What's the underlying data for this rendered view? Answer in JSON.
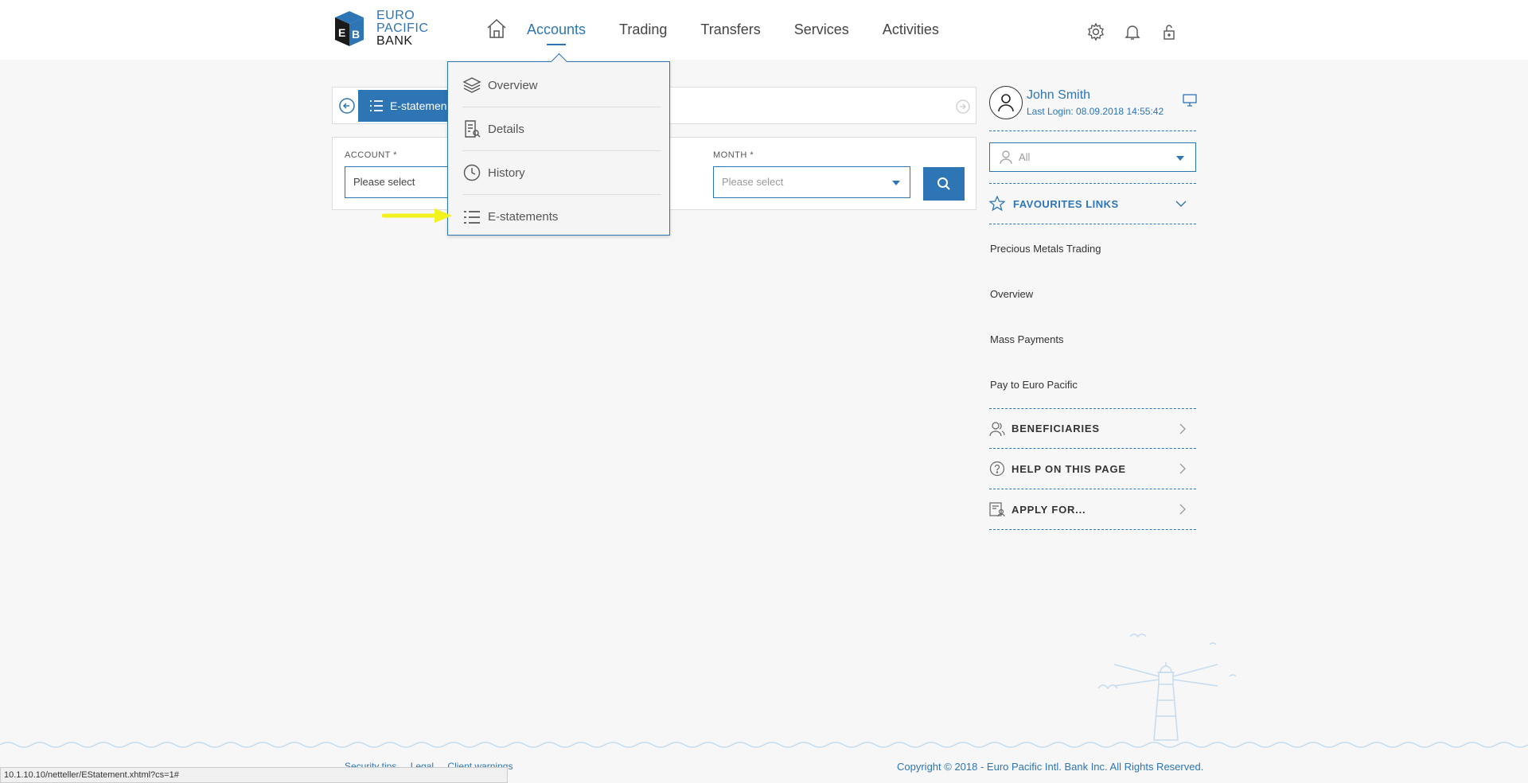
{
  "brand": {
    "line1": "EURO",
    "line2": "PACIFIC",
    "line3": "BANK",
    "accent_color": "#2e75b6"
  },
  "nav": {
    "items": [
      {
        "label": "Accounts",
        "active": true
      },
      {
        "label": "Trading"
      },
      {
        "label": "Transfers"
      },
      {
        "label": "Services"
      },
      {
        "label": "Activities"
      }
    ],
    "icons": [
      "home-icon",
      "gear-icon",
      "bell-icon",
      "unlock-icon"
    ]
  },
  "accounts_menu": {
    "items": [
      {
        "label": "Overview",
        "icon": "layers-icon"
      },
      {
        "label": "Details",
        "icon": "document-search-icon"
      },
      {
        "label": "History",
        "icon": "clock-icon"
      },
      {
        "label": "E-statements",
        "icon": "list-icon"
      }
    ]
  },
  "tabs": {
    "active_label": "E-statements"
  },
  "filter": {
    "account_label": "ACCOUNT *",
    "account_value": "Please select",
    "year_value": "",
    "month_label": "MONTH *",
    "month_placeholder": "Please select"
  },
  "profile": {
    "name": "John Smith",
    "last_login": "Last Login: 08.09.2018 14:55:42"
  },
  "scope_select": {
    "value": "All"
  },
  "favourites": {
    "title": "FAVOURITES LINKS",
    "links": [
      "Precious Metals Trading",
      "Overview",
      "Mass Payments",
      "Pay to Euro Pacific"
    ]
  },
  "side_sections": [
    {
      "label": "BENEFICIARIES",
      "icon": "beneficiaries-icon"
    },
    {
      "label": "HELP ON THIS PAGE",
      "icon": "help-icon"
    },
    {
      "label": "APPLY FOR...",
      "icon": "apply-form-icon"
    }
  ],
  "footer": {
    "links": [
      "Security tips",
      "Legal",
      "Client warnings"
    ],
    "copyright": "Copyright © 2018 - Euro Pacific Intl. Bank Inc. All Rights Reserved."
  },
  "status_bar": {
    "url": "10.1.10.10/netteller/EStatement.xhtml?cs=1#"
  }
}
